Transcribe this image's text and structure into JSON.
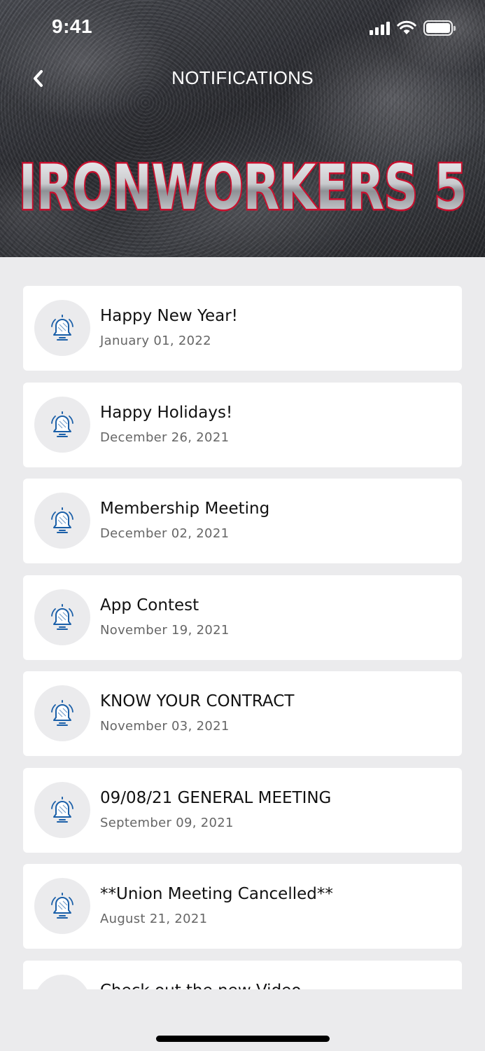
{
  "status_bar": {
    "time": "9:41"
  },
  "nav": {
    "title": "NOTIFICATIONS"
  },
  "brand": {
    "logo_text": "IRONWORKERS 5",
    "logo_color": "#c8102e",
    "accent": "#1a5fa8"
  },
  "notifications": [
    {
      "title": "Happy New Year!",
      "date": "January 01, 2022",
      "icon": "bell-icon"
    },
    {
      "title": "Happy Holidays!",
      "date": "December 26, 2021",
      "icon": "bell-icon"
    },
    {
      "title": "Membership Meeting",
      "date": "December 02, 2021",
      "icon": "bell-icon"
    },
    {
      "title": "App Contest",
      "date": "November 19, 2021",
      "icon": "bell-icon"
    },
    {
      "title": "KNOW YOUR CONTRACT",
      "date": "November 03, 2021",
      "icon": "bell-icon"
    },
    {
      "title": "09/08/21 GENERAL MEETING",
      "date": "September 09, 2021",
      "icon": "bell-icon"
    },
    {
      "title": "**Union Meeting Cancelled**",
      "date": "August 21, 2021",
      "icon": "bell-icon"
    },
    {
      "title": "Check out the new Video",
      "date": "",
      "icon": "bell-icon"
    }
  ]
}
